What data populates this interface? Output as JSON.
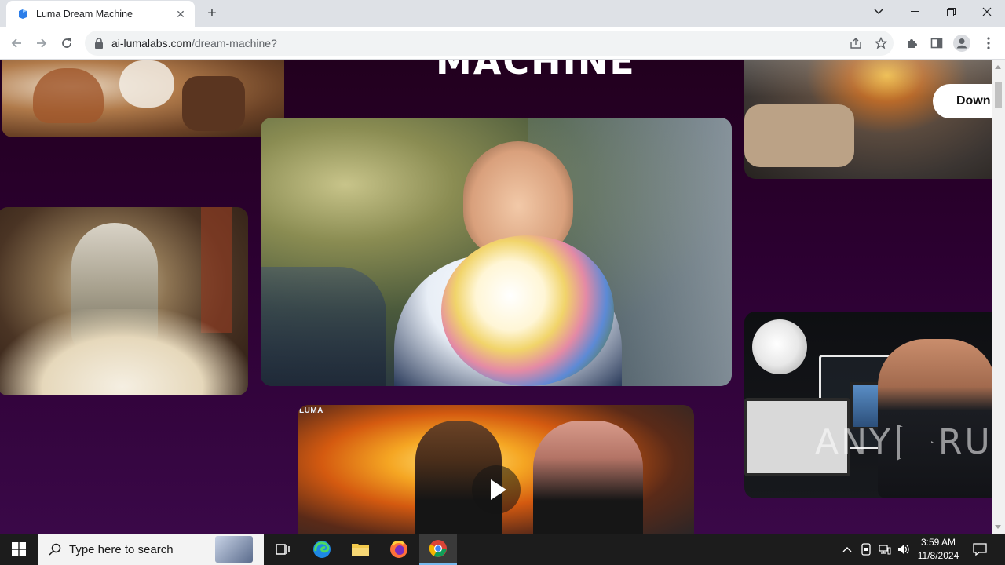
{
  "browser": {
    "tab_title": "Luma Dream Machine",
    "new_tab_label": "+",
    "url_domain": "ai-lumalabs.com",
    "url_path": "/dream-machine?"
  },
  "page": {
    "heading_fragment": "MACHINE",
    "download_button": "Down",
    "brand_mark": "LUMA",
    "watermark_left": "ANY",
    "watermark_right": "RUN"
  },
  "taskbar": {
    "search_placeholder": "Type here to search",
    "time": "3:59 AM",
    "date": "11/8/2024"
  },
  "colors": {
    "page_bg": "#2b0030",
    "chrome_tabstrip": "#dee1e6",
    "taskbar_bg": "#1c1c1c",
    "accent": "#76b9ed"
  },
  "icons": [
    "luma-favicon",
    "close-icon",
    "back-icon",
    "forward-icon",
    "reload-icon",
    "lock-icon",
    "share-icon",
    "star-icon",
    "extensions-icon",
    "sidepanel-icon",
    "profile-icon",
    "menu-icon",
    "play-icon",
    "windows-icon",
    "search-icon",
    "task-view-icon",
    "edge-icon",
    "file-explorer-icon",
    "firefox-icon",
    "chrome-icon",
    "chevron-up-icon",
    "network-icon",
    "volume-icon",
    "notification-icon"
  ]
}
